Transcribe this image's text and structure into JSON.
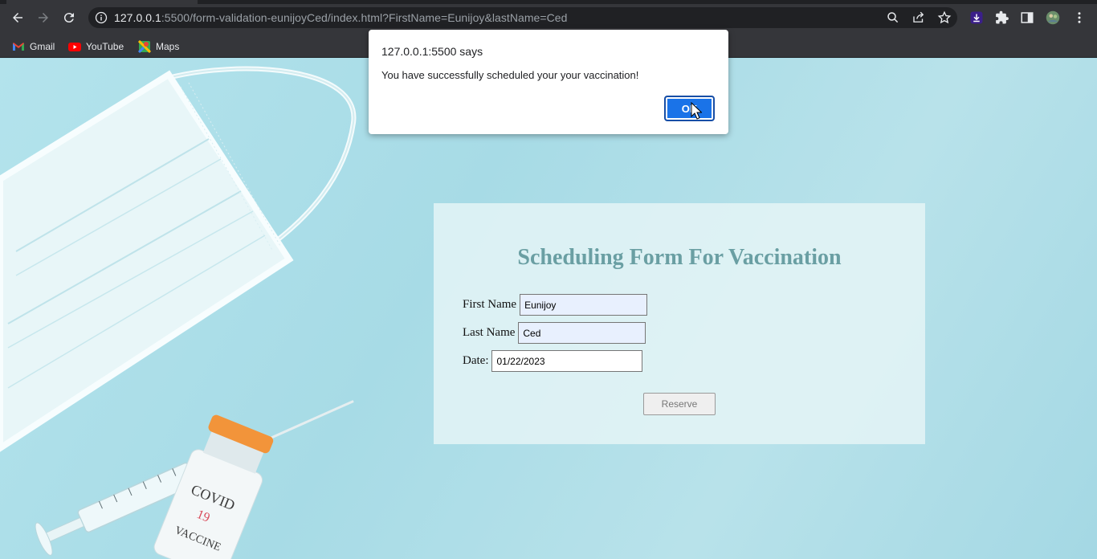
{
  "browser": {
    "url_host": "127.0.0.1",
    "url_rest": ":5500/form-validation-eunijoyCed/index.html?FirstName=Eunijoy&lastName=Ced",
    "bookmarks": [
      {
        "label": "Gmail",
        "icon": "gmail-icon"
      },
      {
        "label": "YouTube",
        "icon": "youtube-icon"
      },
      {
        "label": "Maps",
        "icon": "maps-icon"
      }
    ]
  },
  "dialog": {
    "title": "127.0.0.1:5500 says",
    "message": "You have successfully scheduled your your vaccination!",
    "ok_label": "OK"
  },
  "form": {
    "title": "Scheduling Form For Vaccination",
    "first_name_label": "First Name",
    "first_name_value": "Eunijoy",
    "last_name_label": "Last Name",
    "last_name_value": "Ced",
    "date_label": "Date:",
    "date_value": "01/22/2023",
    "reserve_label": "Reserve"
  },
  "colors": {
    "chrome_dark": "#35363a",
    "page_bg": "#a9dbe6",
    "title_teal": "#6a9fa3",
    "ok_blue": "#1a73e8"
  }
}
